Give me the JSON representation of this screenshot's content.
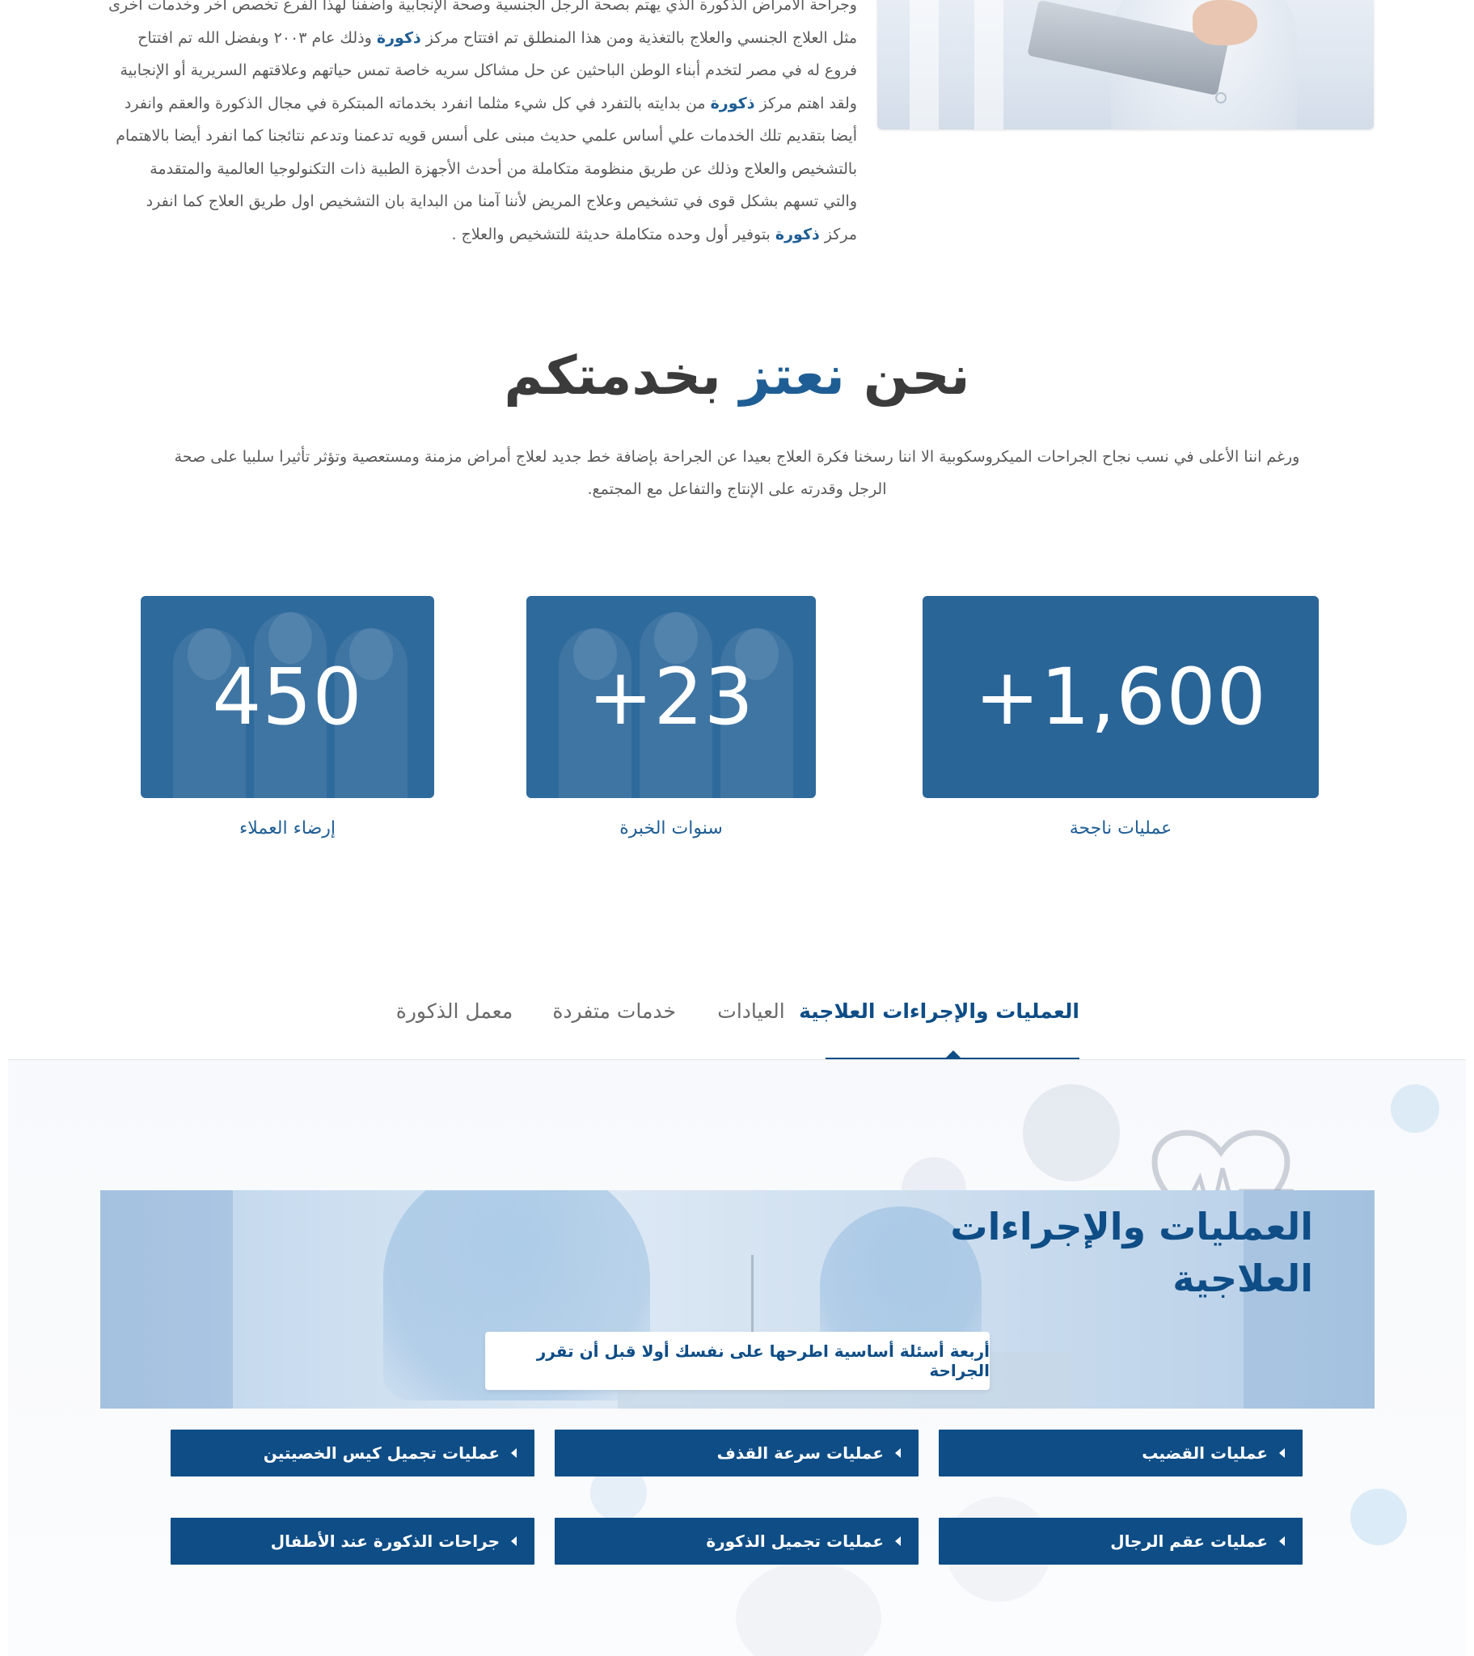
{
  "about": {
    "lines": [
      [
        "وجراحة الأمراض الذكورة الذي يهتم بصحة الرجل الجنسية وصحة الإنجابية وأضفنا لهذا الفرع تخصص آخر وخدمات أخرى"
      ],
      [
        "مثل العلاج الجنسي والعلاج بالتغذية ومن هذا المنطلق تم افتتاح مركز ",
        "ذكورة",
        " وذلك عام ٢٠٠٣ وبفضل الله تم افتتاح"
      ],
      [
        "فروع له في مصر لتخدم أبناء الوطن الباحثين عن حل مشاكل سريه خاصة تمس حياتهم وعلاقتهم السريرية أو الإنجابية"
      ],
      [
        "ولقد اهتم مركز ",
        "ذكورة",
        " من بدايته بالتفرد في كل شيء مثلما انفرد بخدماته المبتكرة في مجال الذكورة والعقم وانفرد"
      ],
      [
        "أيضا بتقديم تلك الخدمات علي أساس علمي حديث مبنى على أسس قويه تدعمنا وتدعم نتائجنا كما انفرد أيضا بالاهتمام"
      ],
      [
        "بالتشخيص والعلاج وذلك عن طريق منظومة متكاملة من أحدث الأجهزة الطبية ذات التكنولوجيا العالمية والمتقدمة"
      ],
      [
        "والتي تسهم بشكل قوى في تشخيص وعلاج المريض لأننا آمنا من البداية بان التشخيص اول طريق العلاج كما انفرد"
      ],
      [
        "مركز ",
        "ذكورة",
        " بتوفير أول وحده متكاملة حديثة للتشخيص والعلاج ."
      ]
    ]
  },
  "pride": {
    "title_start": "نحن ",
    "title_accent": "نعتز",
    "title_end": " بخدمتكم",
    "description": "ورغم اننا الأعلى في نسب نجاح الجراحات الميكروسكوبية الا اننا رسخنا فكرة العلاج بعيدا عن الجراحة بإضافة خط جديد لعلاج أمراض مزمنة ومستعصية وتؤثر تأثيرا سلبيا على صحة الرجل وقدرته على الإنتاج والتفاعل مع المجتمع."
  },
  "stats": [
    {
      "value": "+1,600",
      "label": "عمليات ناجحة"
    },
    {
      "value": "+23",
      "label": "سنوات الخبرة"
    },
    {
      "value": "450",
      "label": "إرضاء العملاء"
    }
  ],
  "tabs": [
    {
      "label": "العمليات والإجراءات العلاجية",
      "active": true
    },
    {
      "label": "العيادات",
      "active": false
    },
    {
      "label": "خدمات متفردة",
      "active": false
    },
    {
      "label": "معمل الذكورة",
      "active": false
    }
  ],
  "operations": {
    "title": "العمليات والإجراءات العلاجية",
    "link_label": "أربعة أسئلة أساسية اطرحها على نفسك أولا قبل أن تقرر الجراحة",
    "buttons": [
      "عمليات القضيب",
      "عمليات سرعة القذف",
      "عمليات تجميل كيس الخصيتين",
      "عمليات عقم الرجال",
      "عمليات تجميل الذكورة",
      "جراحات الذكورة عند الأطفال"
    ]
  },
  "colors": {
    "brand_blue": "#1f5e94",
    "button_navy": "#0e4d86",
    "stat_box": "#2a6598"
  }
}
